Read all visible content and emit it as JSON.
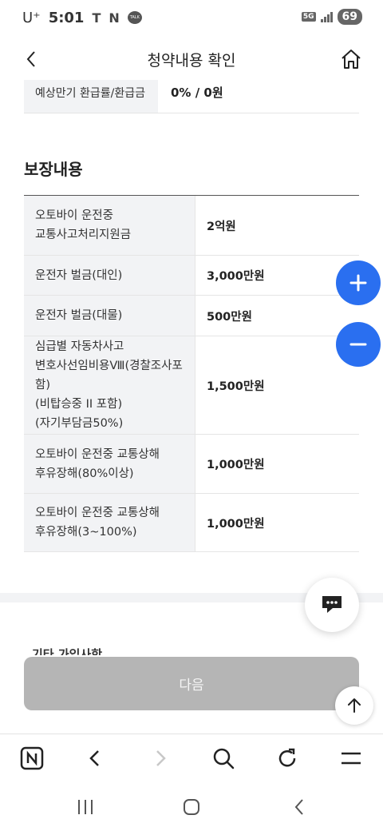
{
  "status_bar": {
    "carrier": "U⁺",
    "time": "5:01",
    "app_icon_t": "T",
    "app_icon_n": "N",
    "talk_icon": "TALK",
    "network": "5G",
    "battery": "69"
  },
  "header": {
    "title": "청약내용 확인",
    "back_icon": "chevron-left-icon",
    "home_icon": "home-icon"
  },
  "previous_row": {
    "label": "예상만기 환급률/환급금",
    "value": "0% / 0원"
  },
  "coverage": {
    "title": "보장내용",
    "rows": [
      {
        "label": "오토바이 운전중\n교통사고처리지원금",
        "value": "2억원"
      },
      {
        "label": "운전자 벌금(대인)",
        "value": "3,000만원"
      },
      {
        "label": "운전자 벌금(대물)",
        "value": "500만원"
      },
      {
        "label": "심급별 자동차사고\n변호사선임비용Ⅷ(경찰조사포함)\n(비탑승중 II 포함)\n(자기부담금50%)",
        "value": "1,500만원"
      },
      {
        "label": "오토바이 운전중 교통상해\n후유장해(80%이상)",
        "value": "1,000만원"
      },
      {
        "label": "오토바이 운전중 교통상해\n후유장해(3~100%)",
        "value": "1,000만원"
      }
    ]
  },
  "next_section_partial": "기타 가입사항",
  "buttons": {
    "next": "다음",
    "zoom_in_icon": "plus-icon",
    "zoom_out_icon": "minus-icon",
    "chat_icon": "chat-icon",
    "scroll_top_icon": "arrow-up-icon"
  },
  "browser_nav": [
    "naver-icon",
    "back-arrow-icon",
    "forward-arrow-icon",
    "search-icon",
    "refresh-icon",
    "menu-icon"
  ],
  "system_nav": [
    "recent-apps-icon",
    "home-circle-icon",
    "system-back-icon"
  ],
  "colors": {
    "accent_blue": "#2a6ff0",
    "disabled_button": "#b5b5b5",
    "table_label_bg": "#f2f3f5"
  }
}
